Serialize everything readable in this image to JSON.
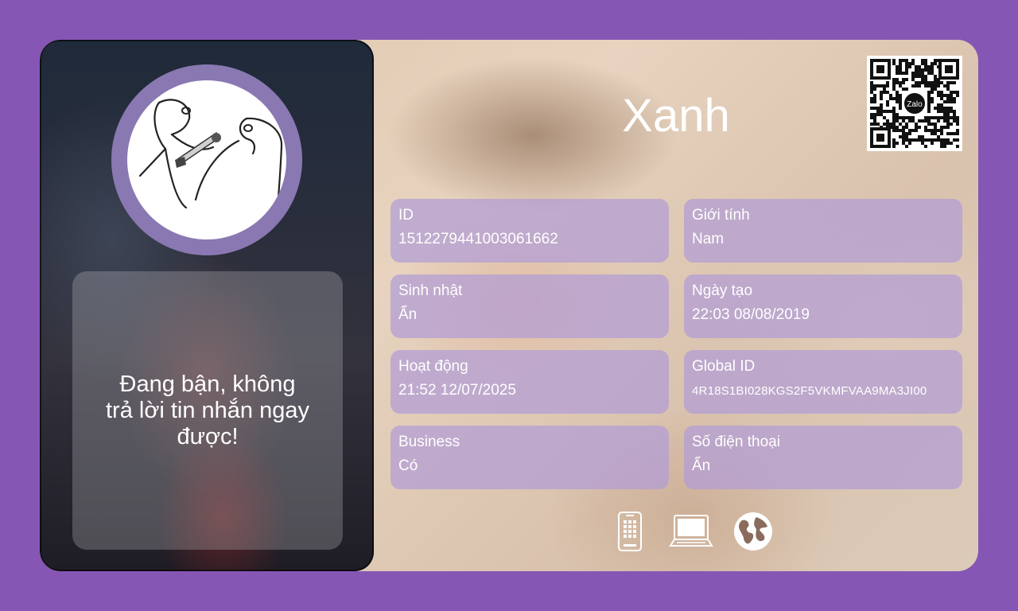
{
  "profile": {
    "name": "Xanh",
    "status": "Đang bận, không trả lời tin nhắn ngay được!"
  },
  "qr": {
    "brand": "Zalo"
  },
  "fields": [
    {
      "label": "ID",
      "value": "1512279441003061662"
    },
    {
      "label": "Giới tính",
      "value": "Nam"
    },
    {
      "label": "Sinh nhật",
      "value": "Ẩn"
    },
    {
      "label": "Ngày tạo",
      "value": "22:03 08/08/2019"
    },
    {
      "label": "Hoạt động",
      "value": "21:52 12/07/2025"
    },
    {
      "label": "Global ID",
      "value": "4R18S1BI028KGS2F5VKMFVAA9MA3JI00"
    },
    {
      "label": "Business",
      "value": "Có"
    },
    {
      "label": "Số điện thoại",
      "value": "Ẩn"
    }
  ],
  "devices": [
    {
      "icon": "mobile-phone-icon"
    },
    {
      "icon": "laptop-icon"
    },
    {
      "icon": "globe-icon"
    }
  ],
  "colors": {
    "background": "#8656b4",
    "field_background": "#b29cd6",
    "avatar_ring": "#8a78b2"
  }
}
